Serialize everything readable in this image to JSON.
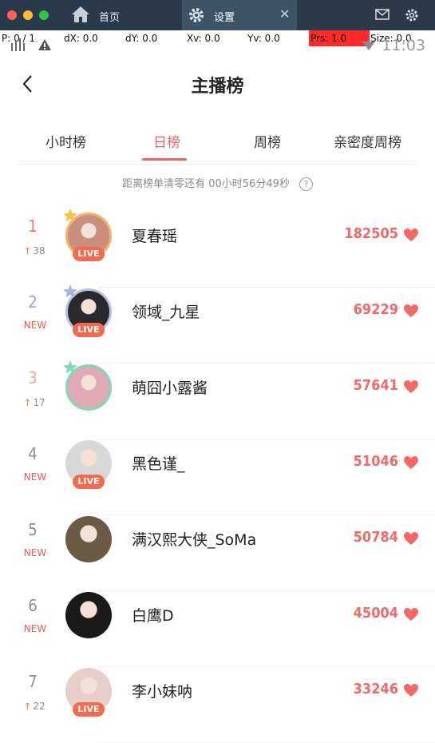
{
  "titlebar": {
    "tabs": [
      {
        "label": "首页",
        "icon": "home-icon"
      },
      {
        "label": "设置",
        "icon": "gear-icon",
        "active": true
      }
    ],
    "right_icons": [
      "mail-icon",
      "settings-icon"
    ]
  },
  "debug": {
    "p": "P: 0 / 1",
    "dx": "dX: 0.0",
    "dy": "dY: 0.0",
    "xv": "Xv: 0.0",
    "yv": "Yv: 0.0",
    "prs": "Prs: 1.0",
    "size": "Size: 0.0"
  },
  "status": {
    "time": "11:03"
  },
  "header": {
    "title": "主播榜"
  },
  "tabs": [
    {
      "label": "小时榜"
    },
    {
      "label": "日榜",
      "active": true
    },
    {
      "label": "周榜"
    },
    {
      "label": "亲密度周榜"
    }
  ],
  "countdown": {
    "text": "距离榜单清零还有 00小时56分49秒"
  },
  "rankings": [
    {
      "rank": "1",
      "change": "38",
      "change_type": "up",
      "name": "夏春瑶",
      "score": "182505",
      "live": "LIVE",
      "rank_color": "#f07a55",
      "ring": "#f5b26b",
      "crown": "#f5c542",
      "bg": "#c88f7e"
    },
    {
      "rank": "2",
      "change": "NEW",
      "change_type": "new",
      "name": "领域_九星",
      "score": "69229",
      "live": "LIVE",
      "rank_color": "#9ba4d6",
      "ring": "#b7c0e8",
      "crown": "#a6b6d8",
      "bg": "#2a2a2e"
    },
    {
      "rank": "3",
      "change": "17",
      "change_type": "up",
      "name": "萌囧小露酱",
      "score": "57641",
      "live": "",
      "rank_color": "#f6a3a3",
      "ring": "#7ed9b5",
      "crown": "#7ed9b5",
      "bg": "#e0a9b6"
    },
    {
      "rank": "4",
      "change": "NEW",
      "change_type": "new",
      "name": "黑色谨_",
      "score": "51046",
      "live": "LIVE",
      "rank_color": "#8e8e8e",
      "ring": "",
      "crown": "",
      "bg": "#d8d8d8"
    },
    {
      "rank": "5",
      "change": "NEW",
      "change_type": "new",
      "name": "满汉熙大侠_SoMa",
      "score": "50784",
      "live": "",
      "rank_color": "#8e8e8e",
      "ring": "",
      "crown": "",
      "bg": "#6b5a44"
    },
    {
      "rank": "6",
      "change": "NEW",
      "change_type": "new",
      "name": "白鹰D",
      "score": "45004",
      "live": "",
      "rank_color": "#8e8e8e",
      "ring": "",
      "crown": "",
      "bg": "#1a1a1a"
    },
    {
      "rank": "7",
      "change": "22",
      "change_type": "up",
      "name": "李小妹呐",
      "score": "33246",
      "live": "LIVE",
      "rank_color": "#8e8e8e",
      "ring": "",
      "crown": "",
      "bg": "#e6cfc8"
    }
  ]
}
